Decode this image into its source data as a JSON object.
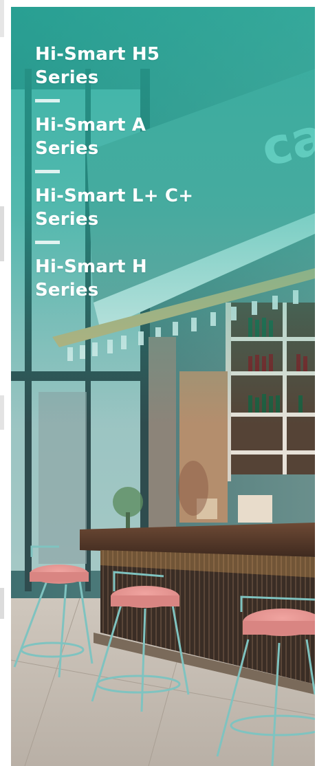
{
  "menu": {
    "items": [
      {
        "line1": "Hi-Smart H5",
        "line2": "Series"
      },
      {
        "line1": "Hi-Smart A",
        "line2": "Series"
      },
      {
        "line1": "Hi-Smart L+ C+",
        "line2": "Series"
      },
      {
        "line1": "Hi-Smart H",
        "line2": "Series"
      }
    ]
  },
  "banner": {
    "sign_text": "ca",
    "accent_color": "#20b2a0"
  }
}
